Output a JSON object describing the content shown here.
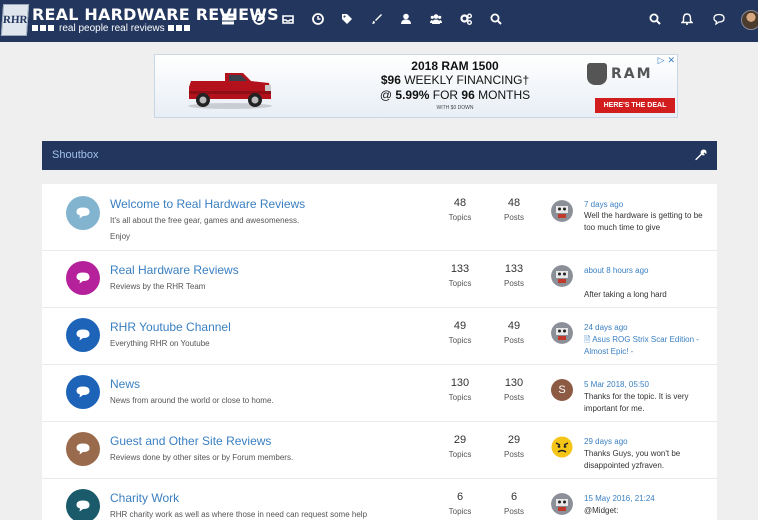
{
  "header": {
    "logo_badge": "RHR",
    "logo_title": "REAL HARDWARE REVIEWS",
    "logo_tagline": "real people real reviews",
    "nav_icons": [
      "list-icon",
      "compass-icon",
      "inbox-icon",
      "clock-icon",
      "tags-icon",
      "brush-icon",
      "user-icon",
      "users-icon",
      "cogs-icon",
      "search-icon"
    ],
    "right_icons": [
      "search-icon",
      "bell-icon",
      "chat-icon",
      "avatar"
    ]
  },
  "ad": {
    "line1": "2018 RAM 1500",
    "line2_pre": "$96",
    "line2_post": " WEEKLY FINANCING†",
    "line3_pre": "@ ",
    "line3_rate": "5.99%",
    "line3_mid": " FOR ",
    "line3_months": "96",
    "line3_post": " MONTHS",
    "line4": "WITH $0 DOWN",
    "brand": "RAM",
    "cta": "HERE'S THE DEAL",
    "close": "▷ ✕"
  },
  "shoutbox": {
    "title": "Shoutbox"
  },
  "forums": [
    {
      "title": "Welcome to Real Hardware Reviews",
      "desc1": "It's all about the free gear, games and awesomeness.",
      "desc2": "Enjoy",
      "icon_color": "#82b4d0",
      "topics": "48",
      "topics_label": "Topics",
      "posts": "48",
      "posts_label": "Posts",
      "last_time": "7 days ago",
      "last_text": "Well the hardware is getting to be too much time to give"
    },
    {
      "title": "Real Hardware Reviews",
      "desc1": "Reviews by the RHR Team",
      "desc2": "",
      "icon_color": "#b5219a",
      "topics": "133",
      "topics_label": "Topics",
      "posts": "133",
      "posts_label": "Posts",
      "last_time": "about 8 hours ago",
      "last_text": "After taking a long hard"
    },
    {
      "title": "RHR Youtube Channel",
      "desc1": "Everything RHR on Youtube",
      "desc2": "",
      "icon_color": "#1d63b8",
      "topics": "49",
      "topics_label": "Topics",
      "posts": "49",
      "posts_label": "Posts",
      "last_time": "24 days ago",
      "last_text": "Asus ROG Strix Scar Edition - Almost Epic! -"
    },
    {
      "title": "News",
      "desc1": "News from around the world or close to home.",
      "desc2": "",
      "icon_color": "#1d63b8",
      "topics": "130",
      "topics_label": "Topics",
      "posts": "130",
      "posts_label": "Posts",
      "last_time": "5 Mar 2018, 05:50",
      "last_text": "Thanks for the topic. It is very important for me."
    },
    {
      "title": "Guest and Other Site Reviews",
      "desc1": "Reviews done by other sites or by Forum members.",
      "desc2": "",
      "icon_color": "#9a6a4c",
      "topics": "29",
      "topics_label": "Topics",
      "posts": "29",
      "posts_label": "Posts",
      "last_time": "29 days ago",
      "last_text": "Thanks Guys, you won't be disappointed yzfraven."
    },
    {
      "title": "Charity Work",
      "desc1": "RHR charity work as well as where those in need can request some help",
      "desc2": "",
      "icon_color": "#1a5a6b",
      "topics": "6",
      "topics_label": "Topics",
      "posts": "6",
      "posts_label": "Posts",
      "last_time": "15 May 2016, 21:24",
      "last_text": "@Midget:"
    }
  ],
  "avatar_letter": "S"
}
